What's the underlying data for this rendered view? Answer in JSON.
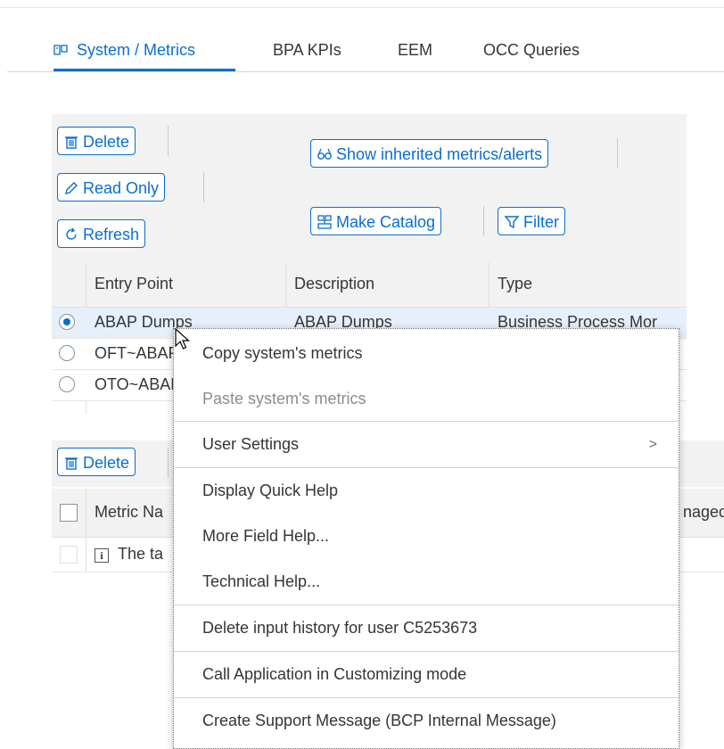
{
  "tabs": [
    {
      "label": "System / Metrics",
      "icon": "system-metrics-icon",
      "active": true
    },
    {
      "label": "BPA KPIs"
    },
    {
      "label": "EEM"
    },
    {
      "label": "OCC Queries"
    }
  ],
  "toolbar": {
    "delete_label": "Delete",
    "read_only_label": "Read Only",
    "refresh_label": "Refresh",
    "show_inherited_label": "Show inherited metrics/alerts",
    "make_catalog_label": "Make Catalog",
    "filter_label": "Filter"
  },
  "entry_table": {
    "columns": [
      "Entry Point",
      "Description",
      "Type"
    ],
    "rows": [
      {
        "entry_point": "ABAP Dumps",
        "description": "ABAP Dumps",
        "type": "Business Process Mor",
        "selected": true
      },
      {
        "entry_point": "OFT~ABAP",
        "description": "",
        "type": "",
        "selected": false
      },
      {
        "entry_point": "OTO~ABAP",
        "description": "",
        "type": "",
        "selected": false
      }
    ]
  },
  "metric_table": {
    "delete_label": "Delete",
    "columns": [
      "Metric Na",
      "nagec"
    ],
    "info_row_text": "The ta"
  },
  "context_menu": {
    "items": [
      {
        "label": "Copy system's metrics"
      },
      {
        "label": "Paste system's metrics",
        "disabled": true
      },
      {
        "label": "User Settings",
        "submenu": true
      },
      {
        "label": "Display Quick Help"
      },
      {
        "label": "More Field Help..."
      },
      {
        "label": "Technical Help..."
      },
      {
        "label": "Delete input history for user C5253673"
      },
      {
        "label": "Call Application in Customizing mode"
      },
      {
        "label": "Create Support Message (BCP Internal Message)"
      }
    ],
    "submenu_arrow": ">"
  },
  "colors": {
    "accent": "#0a6ed1",
    "toolbar_bg": "#f2f2f2",
    "selected_row": "#e5f0fa",
    "text": "#32363a"
  }
}
